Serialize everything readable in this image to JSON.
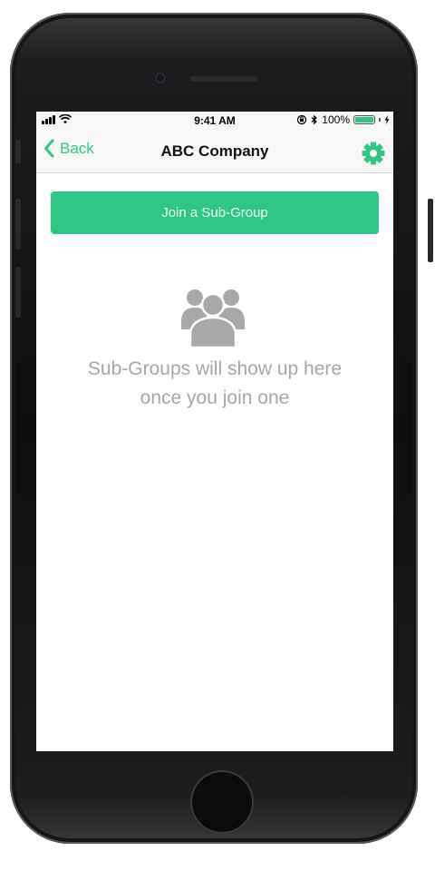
{
  "status_bar": {
    "time": "9:41 AM",
    "battery_percent": "100%",
    "battery_level": 1.0,
    "icons": [
      "signal-bars-icon",
      "wifi-icon",
      "rotation-lock-icon",
      "bluetooth-icon",
      "battery-icon",
      "charging-bolt-icon"
    ]
  },
  "nav": {
    "back_label": "Back",
    "title": "ABC Company",
    "settings_icon": "gear-icon"
  },
  "main": {
    "join_button_label": "Join a Sub-Group",
    "empty_icon": "group-users-icon",
    "empty_line1": "Sub-Groups will show up here",
    "empty_line2": "once you join one"
  },
  "colors": {
    "accent": "#2ec784",
    "muted_text": "#a6a6a6",
    "icon_gray": "#a8a8a8",
    "bar_background": "#f7f7f7"
  }
}
